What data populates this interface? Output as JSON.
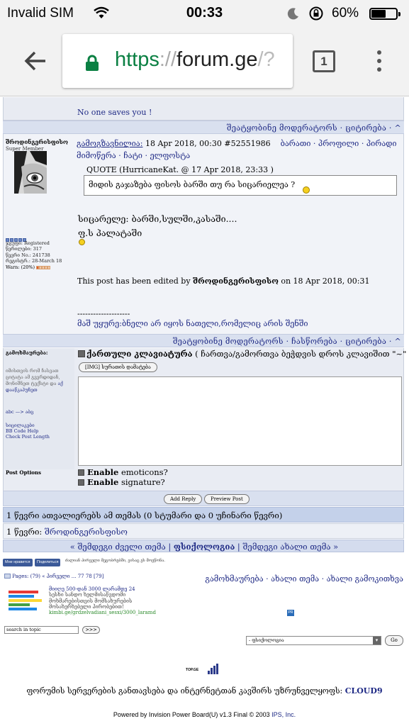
{
  "status_bar": {
    "carrier": "Invalid SIM",
    "time": "00:33",
    "battery": "60%",
    "battery_level": 0.6
  },
  "browser": {
    "url_scheme": "https",
    "url_sep": "://",
    "url_host": "forum.ge",
    "url_rest": "/?",
    "tab_count": "1"
  },
  "post_prev": {
    "text": "No one saves you !",
    "actions": "შეატყობინე მოდერატორს · ციტირება · ^"
  },
  "post": {
    "author": "შროდინგერისფისო",
    "rank": "Super Member",
    "group": "ჯგუფი: Registered",
    "posts": "წერილები: 317",
    "member_no": "წევრი No.: 241738",
    "registered": "რეგისტრ.: 28-March 18",
    "warn": "Warn: (20%)",
    "warn_level": 0.2,
    "header_link": "გამოგზავნილია:",
    "header_date": " 18 Apr 2018, 00:30  #52551986",
    "header_actions": "ბარათი · პროფილი · პირადი მიმოწერა · ჩატი · ელფოსტა",
    "quote_title": "QUOTE (HurricaneKat. @ 17 Apr 2018, 23:33 )",
    "quote_text": "მიდის გაჯაზება ფისოს ბარში თუ რა სიცარიელეა ?",
    "body_line1": "სიცარელე: ბარში,სულში,კასაში....",
    "body_line2": "ფ.ს პალატაში",
    "edited_pre": "This post has been edited by ",
    "edited_by": "შროდინგერისფისო",
    "edited_post": " on 18 Apr 2018, 00:31",
    "dashes": "--------------------",
    "signature": "მაშ უყურე:ბნელი არ იყოს ნათელი,რომელიც არის შენში",
    "actions": "შეატყობინე მოდერატორს · ჩასწორება · ციტირება · ^"
  },
  "reply": {
    "label": "გამოხმაურება:",
    "help_text": "იმისთვის რომ ჩასვათ ციტატა ამ გვერდიდან, მონიშნეთ ტექსტი და",
    "help_link": "აქ დააწკაპუნეთ",
    "arrow": "abc —> აბც",
    "links": [
      "სიცილაკები",
      "BB Code Help",
      "Check Post Length"
    ],
    "keyboard_label": "ქართული კლავიატურა",
    "keyboard_hint": " ( ჩართვა/გამორთვა ბეჭდვის დროს კლავიშით \"~\" )",
    "img_button": "[IMG] სურათის დამატება"
  },
  "options": {
    "label": "Post Options",
    "emoticons": "emoticons?",
    "signature": "signature?",
    "enable": "Enable"
  },
  "buttons": {
    "add_reply": "Add Reply",
    "preview": "Preview Post"
  },
  "active_users": "1 წევრი ათვალიერებს ამ თემას (0 სტუმარი და 0 უჩინარი წევრი)",
  "members_line_prefix": "1 წევრი: ",
  "members_line_name": "შროდინგერისფისო",
  "nav": {
    "prev": "« შემდეგი ძველი თემა",
    "forum": "ფსიქოლოგია",
    "next": "შემდეგი ახალი თემა »"
  },
  "social": {
    "like": "Мне нравится",
    "share": "Поделиться",
    "note": "ძალიან პირველი მეგობრებში, ვისაც ეს მოეწონა."
  },
  "pagination": "Pages: (79) « პირველი ... 77 78 [79]",
  "topic_links": "გამოხმაურება · ახალი თემა · ახალი გამოკითხვა",
  "ad": {
    "title": "მიიღე 500-დან 3000 ლარამდე 24",
    "line2": "სესხი სანდო ხელმისაწვდომი",
    "line3": "მოხმარებისთვის მომსახურების",
    "line4": "მოსახერხებელი პირობებით!",
    "url": "kimbi.ge/grdzelvadiani_sesxi/3000_laramd"
  },
  "search": {
    "placeholder": "search in topic",
    "go": ">>>"
  },
  "jump": {
    "selected": "- ფსიქოლოგია",
    "go": "Go"
  },
  "topge": "TOP.GE",
  "hosting_text": "ფორუმის სერვერების განთავსება და ინტერნეტთან კავშირს უზრუნველყოფს: ",
  "hosting_brand": "CLOUD9",
  "powered_pre": "Powered by Invision Power Board(U) v1.3 Final © 2003  ",
  "powered_brand": "IPS, Inc.",
  "colors": {
    "link": "#1f2a85",
    "bar": "#d9e0ef",
    "url_green": "#0b8043"
  }
}
